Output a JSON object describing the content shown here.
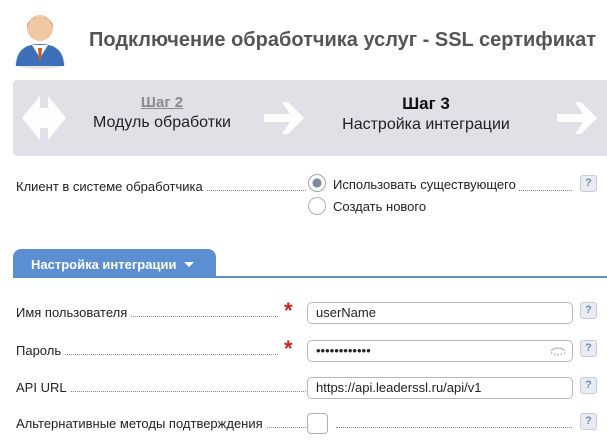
{
  "header": {
    "title": "Подключение обработчика услуг - SSL сертификат",
    "avatar_icon": "user-avatar-icon"
  },
  "wizard": {
    "prev_step": {
      "number": "Шаг 2",
      "name": "Модуль обработки"
    },
    "current_step": {
      "number": "Шаг 3",
      "name": "Настройка интеграции"
    }
  },
  "client": {
    "label": "Клиент в системе обработчика",
    "options": [
      {
        "label": "Использовать существующего",
        "selected": true
      },
      {
        "label": "Создать нового",
        "selected": false
      }
    ]
  },
  "section": {
    "title": "Настройка интеграции"
  },
  "fields": {
    "username": {
      "label": "Имя пользователя",
      "value": "userName",
      "required": true
    },
    "password": {
      "label": "Пароль",
      "value": "••••••••••••",
      "required": true
    },
    "api_url": {
      "label": "API URL",
      "value": "https://api.leaderssl.ru/api/v1"
    },
    "alt_methods": {
      "label": "Альтернативные методы подтверждения",
      "checked": false
    }
  },
  "help": {
    "label": "?"
  },
  "colors": {
    "accent": "#5b8fd1",
    "required": "#d01f1f",
    "wizard_bg": "#dfe1e6"
  }
}
